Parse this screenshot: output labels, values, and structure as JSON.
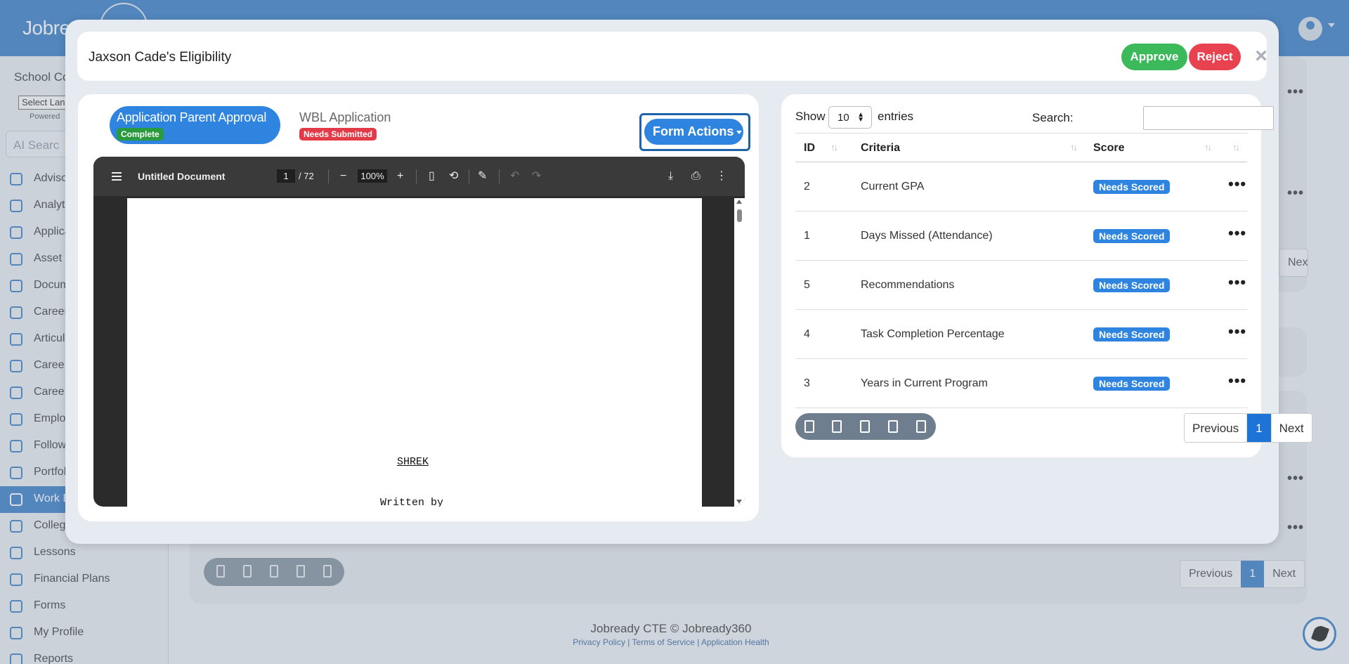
{
  "background": {
    "brand": "Jobre",
    "school_label": "School Co",
    "language_select": "Select Lan",
    "powered_by": "Powered",
    "ai_search": "AI Searc",
    "nav_items": [
      {
        "label": "Adviso",
        "icon": "advisor-icon"
      },
      {
        "label": "Analyti",
        "icon": "chart-icon"
      },
      {
        "label": "Applica",
        "icon": "application-icon"
      },
      {
        "label": "Asset M",
        "icon": "asset-icon"
      },
      {
        "label": "Docum",
        "icon": "document-icon"
      },
      {
        "label": "Career",
        "icon": "user-icon"
      },
      {
        "label": "Articul",
        "icon": "forward-icon"
      },
      {
        "label": "Caree",
        "icon": "rocket-icon"
      },
      {
        "label": "Caree",
        "icon": "network-icon"
      },
      {
        "label": "Emplo",
        "icon": "user-icon"
      },
      {
        "label": "Follow",
        "icon": "user-icon"
      },
      {
        "label": "Portfol",
        "icon": "folder-icon"
      },
      {
        "label": "Work B",
        "icon": "user-icon"
      },
      {
        "label": "College",
        "icon": "college-icon"
      },
      {
        "label": "Lessons",
        "icon": "lessons-icon"
      },
      {
        "label": "Financial Plans",
        "icon": "piggy-bank-icon"
      },
      {
        "label": "Forms",
        "icon": "form-icon"
      },
      {
        "label": "My Profile",
        "icon": "user-icon"
      },
      {
        "label": "Reports",
        "icon": "report-icon"
      }
    ],
    "pager": {
      "previous": "Previous",
      "current": "1",
      "next": "Next"
    },
    "pager_partial_next": "Next",
    "footer": "Jobready CTE © Jobready360",
    "footer_links": "Privacy Policy | Terms of Service | Application Health"
  },
  "modal": {
    "title": "Jaxson Cade's Eligibility",
    "approve": "Approve",
    "reject": "Reject",
    "close": "×",
    "tabs": [
      {
        "label": "Application Parent Approval",
        "badge": "Complete"
      },
      {
        "label": "WBL Application",
        "badge": "Needs Submitted"
      }
    ],
    "form_actions": "Form Actions",
    "viewer": {
      "doc_title": "Untitled Document",
      "page": "1",
      "page_total": "/ 72",
      "zoom": "100%",
      "page_heading": "SHREK",
      "page_line": "Written by"
    },
    "table": {
      "show_label": "Show",
      "entries_value": "10",
      "entries_label": "entries",
      "search_label": "Search:",
      "search_value": "",
      "columns": [
        "ID",
        "Criteria",
        "Score"
      ],
      "rows": [
        {
          "id": "2",
          "criteria": "Current GPA",
          "score": "Needs Scored"
        },
        {
          "id": "1",
          "criteria": "Days Missed (Attendance)",
          "score": "Needs Scored"
        },
        {
          "id": "5",
          "criteria": "Recommendations",
          "score": "Needs Scored"
        },
        {
          "id": "4",
          "criteria": "Task Completion Percentage",
          "score": "Needs Scored"
        },
        {
          "id": "3",
          "criteria": "Years in Current Program",
          "score": "Needs Scored"
        }
      ],
      "pager": {
        "previous": "Previous",
        "current": "1",
        "next": "Next"
      }
    }
  },
  "colors": {
    "primary": "#2e84de",
    "approve": "#3cb95a",
    "reject": "#e8414f",
    "complete": "#2a9a3e",
    "needs_submitted": "#e23b47"
  }
}
